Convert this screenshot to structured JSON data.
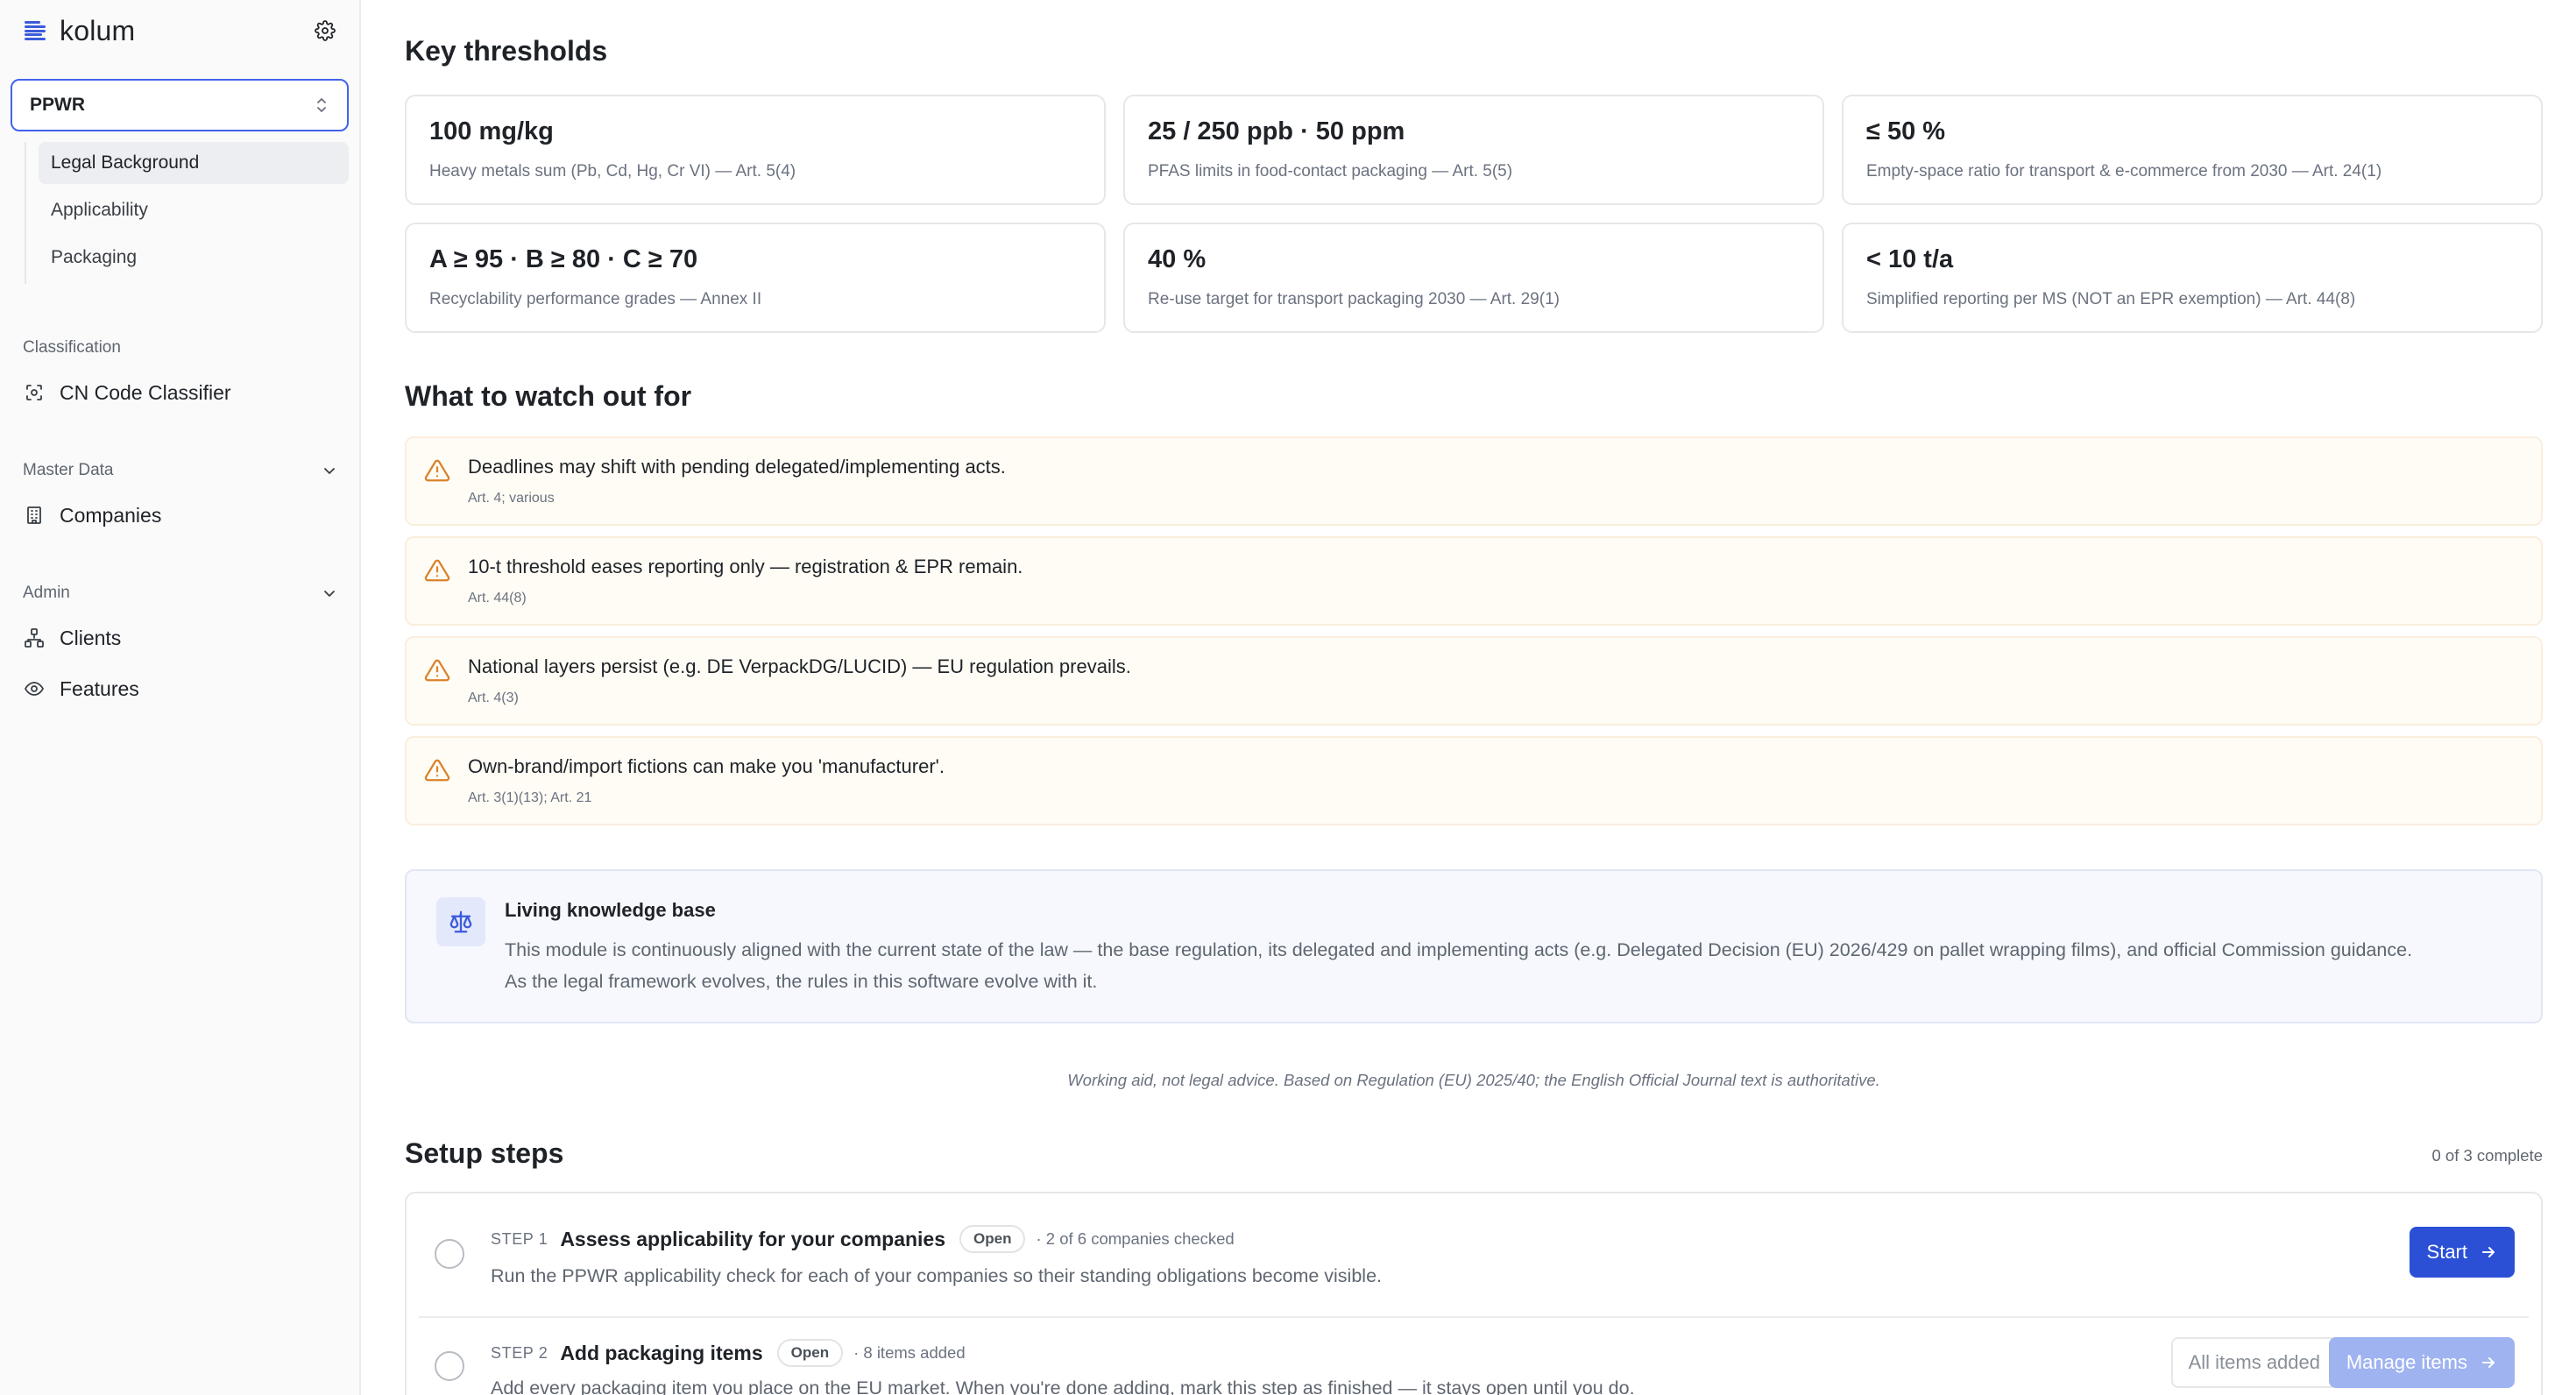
{
  "sidebar": {
    "brand": "kolum",
    "regulation": "PPWR",
    "subnav": [
      {
        "label": "Legal Background",
        "active": true
      },
      {
        "label": "Applicability",
        "active": false
      },
      {
        "label": "Packaging",
        "active": false
      }
    ],
    "sections": {
      "classification": "Classification",
      "master_data": "Master Data",
      "admin": "Admin"
    },
    "items": {
      "cn_code": "CN Code Classifier",
      "companies": "Companies",
      "clients": "Clients",
      "features": "Features"
    }
  },
  "thresholds": {
    "title": "Key thresholds",
    "cards": [
      {
        "value": "100 mg/kg",
        "desc": "Heavy metals sum (Pb, Cd, Hg, Cr VI) — Art. 5(4)"
      },
      {
        "value": "25 / 250 ppb · 50 ppm",
        "desc": "PFAS limits in food-contact packaging — Art. 5(5)"
      },
      {
        "value": "≤ 50 %",
        "desc": "Empty-space ratio for transport & e-commerce from 2030 — Art. 24(1)"
      },
      {
        "value": "A ≥ 95 · B ≥ 80 · C ≥ 70",
        "desc": "Recyclability performance grades — Annex II"
      },
      {
        "value": "40 %",
        "desc": "Re-use target for transport packaging 2030 — Art. 29(1)"
      },
      {
        "value": "< 10 t/a",
        "desc": "Simplified reporting per MS (NOT an EPR exemption) — Art. 44(8)"
      }
    ]
  },
  "watch": {
    "title": "What to watch out for",
    "items": [
      {
        "text": "Deadlines may shift with pending delegated/implementing acts.",
        "ref": "Art. 4; various"
      },
      {
        "text": "10-t threshold eases reporting only — registration & EPR remain.",
        "ref": "Art. 44(8)"
      },
      {
        "text": "National layers persist (e.g. DE VerpackDG/LUCID) — EU regulation prevails.",
        "ref": "Art. 4(3)"
      },
      {
        "text": "Own-brand/import fictions can make you 'manufacturer'.",
        "ref": "Art. 3(1)(13); Art. 21"
      }
    ]
  },
  "knowledge": {
    "title": "Living knowledge base",
    "text1": "This module is continuously aligned with the current state of the law — the base regulation, its delegated and implementing acts (e.g. Delegated Decision (EU) 2026/429 on pallet wrapping films), and official Commission guidance.",
    "text2": "As the legal framework evolves, the rules in this software evolve with it."
  },
  "disclaimer": "Working aid, not legal advice. Based on Regulation (EU) 2025/40; the English Official Journal text is authoritative.",
  "setup": {
    "title": "Setup steps",
    "progress": "0 of 3 complete",
    "steps": [
      {
        "no": "STEP 1",
        "title": "Assess applicability for your companies",
        "badge": "Open",
        "meta": "· 2 of 6 companies checked",
        "desc": "Run the PPWR applicability check for each of your companies so their standing obligations become visible.",
        "primary": "Start"
      },
      {
        "no": "STEP 2",
        "title": "Add packaging items",
        "badge": "Open",
        "meta": "· 8 items added",
        "desc": "Add every packaging item you place on the EU market. When you're done adding, mark this step as finished — it stays open until you do.",
        "secondary": "All items added",
        "primary": "Manage items"
      }
    ]
  }
}
